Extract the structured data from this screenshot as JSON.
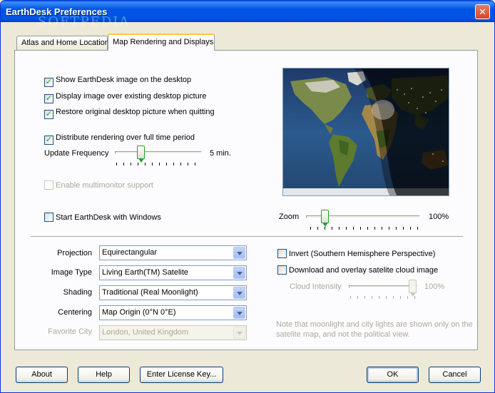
{
  "window": {
    "title": "EarthDesk Preferences",
    "watermark": "SOFTPEDIA"
  },
  "tabs": [
    {
      "label": "Atlas and Home Location",
      "selected": false
    },
    {
      "label": "Map Rendering and Displays",
      "selected": true
    }
  ],
  "options": {
    "show_image": {
      "label": "Show EarthDesk image on the desktop",
      "checked": true
    },
    "display_over": {
      "label": "Display image over existing desktop picture",
      "checked": true
    },
    "restore_original": {
      "label": "Restore original desktop picture when quitting",
      "checked": true
    },
    "distribute": {
      "label": "Distribute rendering over full time period",
      "checked": true
    },
    "multimonitor": {
      "label": "Enable multimonitor support",
      "checked": false,
      "enabled": false
    },
    "start_with_windows": {
      "label": "Start EarthDesk with Windows",
      "checked": false
    }
  },
  "update_frequency": {
    "label": "Update Frequency",
    "value": "5 min.",
    "level": 0.28
  },
  "zoom": {
    "label": "Zoom",
    "value": "100%",
    "level": 0.1
  },
  "fields": [
    {
      "label": "Projection",
      "value": "Equirectangular",
      "enabled": true
    },
    {
      "label": "Image Type",
      "value": "Living Earth(TM) Satelite",
      "enabled": true
    },
    {
      "label": "Shading",
      "value": "Traditional (Real Moonlight)",
      "enabled": true
    },
    {
      "label": "Centering",
      "value": "Map Origin (0°N 0°E)",
      "enabled": true
    },
    {
      "label": "Favorite City",
      "value": "London, United Kingdom",
      "enabled": false
    }
  ],
  "invert": {
    "label": "Invert (Southern Hemisphere Perspective)",
    "checked": false
  },
  "cloud": {
    "label": "Download and overlay satelite cloud image",
    "checked": false
  },
  "cloud_intensity": {
    "label": "Cloud Intensity",
    "value": "100%",
    "level": 1.0,
    "enabled": false
  },
  "note": "Note that moonlight and city lights are shown only on the satelite map, and not the political view.",
  "buttons": {
    "about": "About",
    "help": "Help",
    "license": "Enter License Key...",
    "ok": "OK",
    "cancel": "Cancel"
  },
  "colors": {
    "title_bar": "#0054e3",
    "dialog_bg": "#ece9d8",
    "check_mark": "#21a121",
    "slider_thumb": "#20a120"
  }
}
